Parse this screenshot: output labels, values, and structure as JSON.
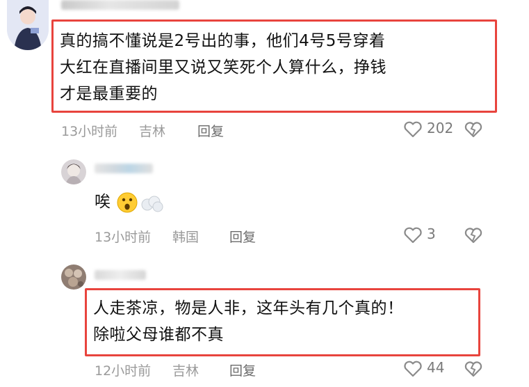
{
  "comments": [
    {
      "text_lines": [
        "真的搞不懂说是2号出的事，他们4号5号穿着",
        "大红在直播间里又说又笑死个人算什么，挣钱",
        "才是最重要的"
      ],
      "time": "13小时前",
      "location": "吉林",
      "reply_label": "回复",
      "likes": "202"
    },
    {
      "text": "唉",
      "time": "13小时前",
      "location": "韩国",
      "reply_label": "回复",
      "likes": "3"
    },
    {
      "text_lines": [
        "人走茶凉，物是人非，这年头有几个真的！",
        "除啦父母谁都不真"
      ],
      "time": "12小时前",
      "location": "吉林",
      "reply_label": "回复",
      "likes": "44"
    }
  ],
  "colors": {
    "highlight": "#e8443d",
    "meta": "#9a9a9a",
    "text": "#111111"
  },
  "icons": [
    "heart-outline-icon",
    "broken-heart-icon",
    "surprised-face-emoji",
    "puff-cloud-emoji"
  ]
}
